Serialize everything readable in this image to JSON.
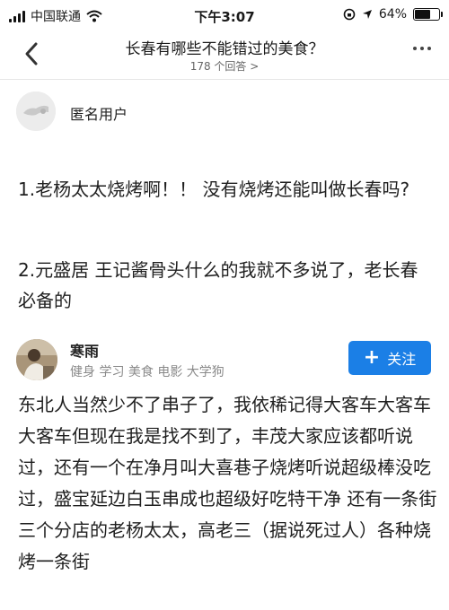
{
  "status_bar": {
    "carrier": "中国联通",
    "time": "下午3:07",
    "battery": "64%",
    "battery_level": 0.64,
    "icons": [
      "signal-icon",
      "wifi-icon",
      "screen-lock-icon",
      "location-icon",
      "battery-icon"
    ]
  },
  "nav": {
    "title": "长春有哪些不能错过的美食？",
    "subtitle": "178 个回答 >",
    "icons": [
      "back-chevron-icon",
      "more-dots-icon"
    ]
  },
  "answer1": {
    "author": "匿名用户",
    "paragraphs": [
      "1.老杨太太烧烤啊！！ 没有烧烤还能叫做长春吗?",
      "2.元盛居 王记酱骨头什么的我就不多说了，老长春必备的"
    ]
  },
  "answer2": {
    "author": "寒雨",
    "tags": "健身 学习 美食 电影 大学狗",
    "follow_label": "关注",
    "follow_color": "#1b7fe6",
    "text": "东北人当然少不了串子了，我依稀记得大客车大客车大客车但现在我是找不到了，丰茂大家应该都听说过，还有一个在净月叫大喜巷子烧烤听说超级棒没吃过，盛宝延边白玉串成也超级好吃特干净 还有一条街三个分店的老杨太太，高老三（据说死过人）各种烧烤一条街"
  }
}
